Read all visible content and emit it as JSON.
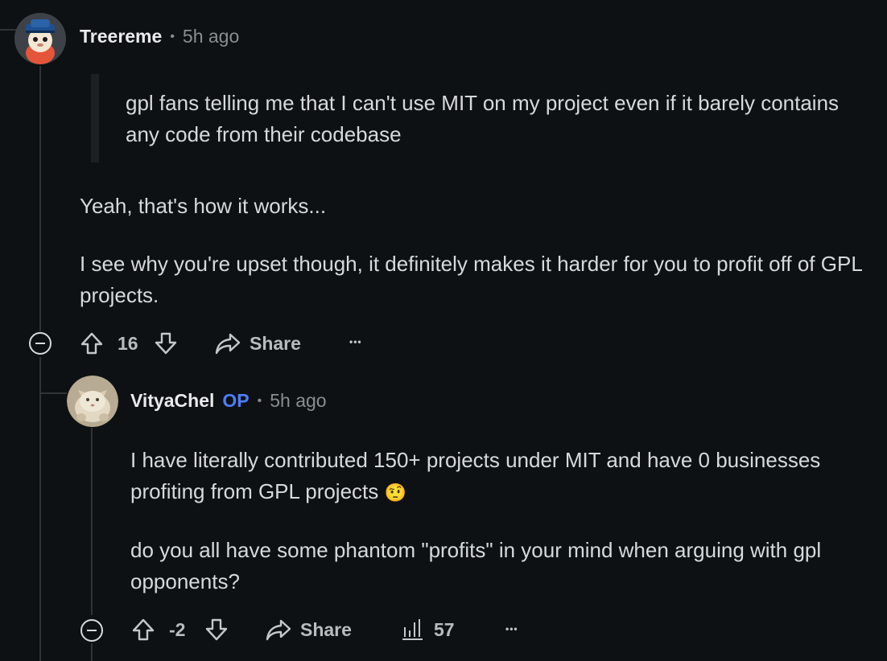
{
  "comment1": {
    "username": "Treereme",
    "separator": "•",
    "time": "5h ago",
    "quote": "gpl fans telling me that I can't use MIT on my project even if it barely contains any code from their codebase",
    "para1": "Yeah, that's how it works...",
    "para2": "I see why you're upset though, it definitely makes it harder for you to profit off of GPL projects.",
    "votes": "16",
    "share_label": "Share",
    "more_label": "•••"
  },
  "comment2": {
    "username": "VityaChel",
    "op_badge": "OP",
    "separator": "•",
    "time": "5h ago",
    "para1": "I have literally contributed 150+ projects under MIT and have 0 businesses profiting from GPL projects",
    "emoji": "🤨",
    "para2": "do you all have some phantom \"profits\" in your mind when arguing with gpl opponents?",
    "votes": "-2",
    "share_label": "Share",
    "views": "57",
    "more_label": "•••"
  },
  "colors": {
    "background": "#0e1113",
    "text": "#d7dadc",
    "op_badge": "#4d7ef7",
    "muted": "#8a8d91"
  },
  "icons": [
    "upvote-icon",
    "downvote-icon",
    "share-icon",
    "collapse-icon",
    "views-icon",
    "more-icon"
  ]
}
